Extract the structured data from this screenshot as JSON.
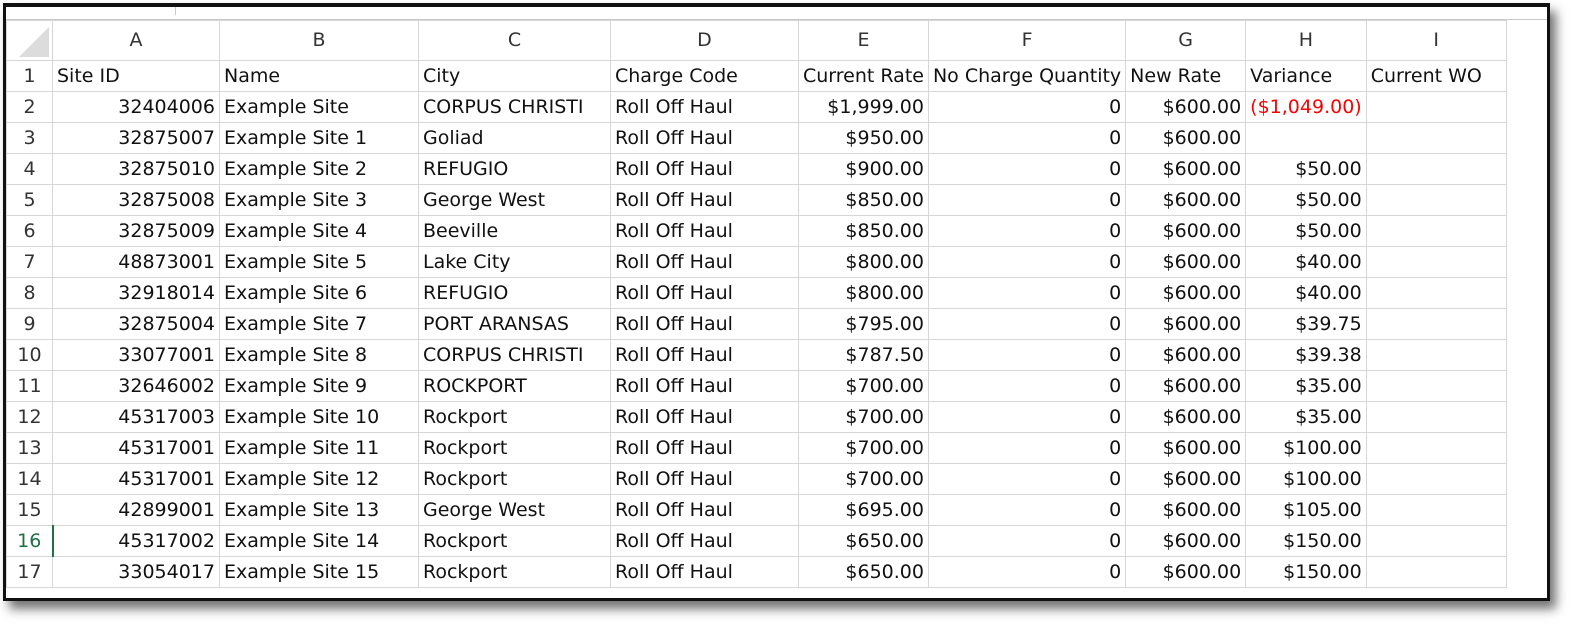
{
  "columns": [
    "A",
    "B",
    "C",
    "D",
    "E",
    "F",
    "G",
    "H",
    "I"
  ],
  "header_row": {
    "number": "1",
    "cells": [
      "Site ID",
      "Name",
      "City",
      "Charge Code",
      "Current Rate",
      "No Charge Quantity",
      "New Rate",
      "Variance",
      "Current WO"
    ]
  },
  "rows": [
    {
      "number": "2",
      "cells": [
        "32404006",
        "Example Site",
        "CORPUS CHRISTI",
        "Roll Off Haul",
        "$1,999.00",
        "0",
        "$600.00",
        "($1,049.00)",
        ""
      ]
    },
    {
      "number": "3",
      "cells": [
        "32875007",
        "Example Site 1",
        "Goliad",
        "Roll Off Haul",
        "$950.00",
        "0",
        "$600.00",
        "",
        ""
      ]
    },
    {
      "number": "4",
      "cells": [
        "32875010",
        "Example Site 2",
        "REFUGIO",
        "Roll Off Haul",
        "$900.00",
        "0",
        "$600.00",
        "$50.00",
        ""
      ]
    },
    {
      "number": "5",
      "cells": [
        "32875008",
        "Example Site 3",
        "George West",
        "Roll Off Haul",
        "$850.00",
        "0",
        "$600.00",
        "$50.00",
        ""
      ]
    },
    {
      "number": "6",
      "cells": [
        "32875009",
        "Example Site 4",
        "Beeville",
        "Roll Off Haul",
        "$850.00",
        "0",
        "$600.00",
        "$50.00",
        ""
      ]
    },
    {
      "number": "7",
      "cells": [
        "48873001",
        "Example Site 5",
        "Lake City",
        "Roll Off Haul",
        "$800.00",
        "0",
        "$600.00",
        "$40.00",
        ""
      ]
    },
    {
      "number": "8",
      "cells": [
        "32918014",
        "Example Site 6",
        "REFUGIO",
        "Roll Off Haul",
        "$800.00",
        "0",
        "$600.00",
        "$40.00",
        ""
      ]
    },
    {
      "number": "9",
      "cells": [
        "32875004",
        "Example Site 7",
        "PORT ARANSAS",
        "Roll Off Haul",
        "$795.00",
        "0",
        "$600.00",
        "$39.75",
        ""
      ]
    },
    {
      "number": "10",
      "cells": [
        "33077001",
        "Example Site 8",
        "CORPUS CHRISTI",
        "Roll Off Haul",
        "$787.50",
        "0",
        "$600.00",
        "$39.38",
        ""
      ]
    },
    {
      "number": "11",
      "cells": [
        "32646002",
        "Example Site 9",
        "ROCKPORT",
        "Roll Off Haul",
        "$700.00",
        "0",
        "$600.00",
        "$35.00",
        ""
      ]
    },
    {
      "number": "12",
      "cells": [
        "45317003",
        "Example Site 10",
        "Rockport",
        "Roll Off Haul",
        "$700.00",
        "0",
        "$600.00",
        "$35.00",
        ""
      ]
    },
    {
      "number": "13",
      "cells": [
        "45317001",
        "Example Site 11",
        "Rockport",
        "Roll Off Haul",
        "$700.00",
        "0",
        "$600.00",
        "$100.00",
        ""
      ]
    },
    {
      "number": "14",
      "cells": [
        "45317001",
        "Example Site 12",
        "Rockport",
        "Roll Off Haul",
        "$700.00",
        "0",
        "$600.00",
        "$100.00",
        ""
      ]
    },
    {
      "number": "15",
      "cells": [
        "42899001",
        "Example Site 13",
        "George West",
        "Roll Off Haul",
        "$695.00",
        "0",
        "$600.00",
        "$105.00",
        ""
      ]
    },
    {
      "number": "16",
      "cells": [
        "45317002",
        "Example Site 14",
        "Rockport",
        "Roll Off Haul",
        "$650.00",
        "0",
        "$600.00",
        "$150.00",
        ""
      ]
    },
    {
      "number": "17",
      "cells": [
        "33054017",
        "Example Site 15",
        "Rockport",
        "Roll Off Haul",
        "$650.00",
        "0",
        "$600.00",
        "$150.00",
        ""
      ]
    }
  ],
  "colors": {
    "negative_value": "#ff0000",
    "active_row_marker": "#1e7145"
  }
}
